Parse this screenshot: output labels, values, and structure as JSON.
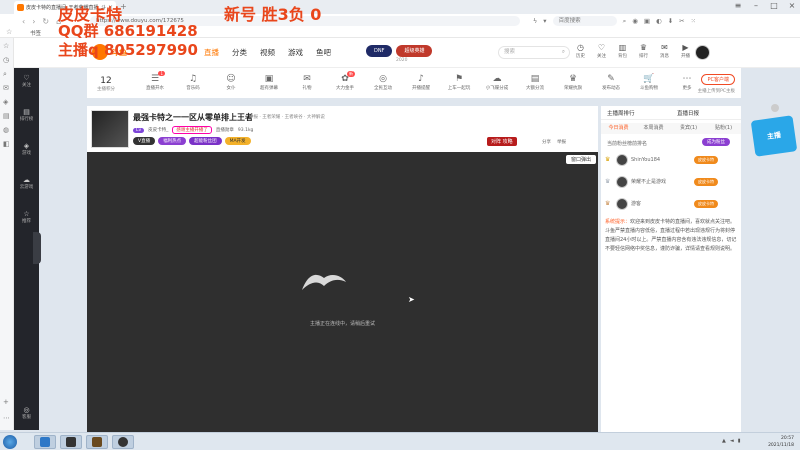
{
  "browser": {
    "tab_title": "皮皮卡特的直播间_王者荣耀直播_斗鱼直播",
    "url": "https://www.douyu.com/172675",
    "search_engine": "百度搜索",
    "bookmark_label": "书签",
    "bookmark_text": "手机收藏夹"
  },
  "overlay": {
    "line1": "皮皮卡特",
    "line2": "新号  胜3负 0",
    "line3": "QQ群 686191428",
    "line4": "主播q 805297990"
  },
  "site": {
    "logo": "斗鱼",
    "nav": [
      "直播",
      "分类",
      "视频",
      "游戏",
      "鱼吧"
    ],
    "promo_a": "DNF",
    "promo_b": "超级英雄",
    "promo_sub": "2020",
    "search_placeholder": "搜索",
    "header_icons": [
      {
        "icon": "history-icon",
        "label": "历史"
      },
      {
        "icon": "follow-icon",
        "label": "关注"
      },
      {
        "icon": "bag-icon",
        "label": "背包"
      },
      {
        "icon": "rank-icon",
        "label": "排行"
      },
      {
        "icon": "message-icon",
        "label": "消息"
      },
      {
        "icon": "camera-icon",
        "label": "开播"
      }
    ]
  },
  "streamer_bar": {
    "level": "12",
    "level_label": "主播积分",
    "tools": [
      {
        "label": "直播开水",
        "glyph": "☰",
        "badge": "1"
      },
      {
        "label": "音乐码",
        "glyph": "♫"
      },
      {
        "label": "女仆",
        "glyph": "☺"
      },
      {
        "label": "超有弹幕",
        "glyph": "▣"
      },
      {
        "label": "礼物",
        "glyph": "✉"
      },
      {
        "label": "大力金手",
        "glyph": "✿",
        "badge": "新"
      },
      {
        "label": "全民互动",
        "glyph": "◎"
      },
      {
        "label": "开播提醒",
        "glyph": "♪"
      },
      {
        "label": "上车一起玩",
        "glyph": "⚑"
      },
      {
        "label": "小飞碟分成",
        "glyph": "☁"
      },
      {
        "label": "大额分流",
        "glyph": "▤"
      },
      {
        "label": "荣耀抗旗",
        "glyph": "♛"
      },
      {
        "label": "发布动态",
        "glyph": "✎"
      },
      {
        "label": "斗鱼购物",
        "glyph": "🛒"
      },
      {
        "label": "更多",
        "glyph": "⋯"
      }
    ],
    "pc_client": "PC客户端",
    "pc_sub": "主播上传到PC主板"
  },
  "room": {
    "title": "最强卡特之一一区从零单排上王者",
    "meta": "举报 · 王者荣耀 · 王者峡谷 · 大神解说",
    "owner": "皮皮卡特_",
    "level_chip": "Lv",
    "fans_chip": "感谢主播开播了",
    "badge_text": "直播勋章",
    "hot": "93.1kg",
    "tags": [
      "V直播",
      "福利热点",
      "超能粉丝团",
      "MA开发"
    ],
    "viewers": "196047",
    "follow": "关注",
    "fight": "对阵 攻略",
    "share": "分享",
    "report": "举报"
  },
  "player": {
    "popout": "窗口弹出",
    "message": "主播正在连线中，请稍后重试"
  },
  "right_panel": {
    "head_a": "主播周排行",
    "head_b": "直播日报",
    "tabs": [
      "今日消费",
      "本周消费",
      "贵宾(1)",
      "贴粉(1)"
    ],
    "rank_header": "当前粉丝榜前排名",
    "become_btn": "成为粉丝",
    "ranks": [
      {
        "name": "ShinYou184",
        "badge": "皮皮卡特"
      },
      {
        "name": "荣耀不止是游戏",
        "badge": "皮皮卡特"
      },
      {
        "name": "游客",
        "badge": "皮皮卡特"
      }
    ],
    "sys_key": "系统提示：",
    "sys_text": "欢迎来到皮皮卡特的直播间，喜欢就点关注吧。斗鱼严禁直播内容低俗，直播过程中若出现违规行为将封停直播间24小时以上。严禁直播内容含有违法违规信息，切记不要轻信网络中奖信息，谨防诈骗，详情请查看规则说明。"
  },
  "left_nav": [
    {
      "icon": "heart-icon",
      "label": "关注"
    },
    {
      "icon": "list-icon",
      "label": "排行榜"
    },
    {
      "icon": "gamepad-icon",
      "label": "游戏"
    },
    {
      "icon": "cloud-icon",
      "label": "云游戏"
    },
    {
      "icon": "star-icon",
      "label": "推荐"
    },
    {
      "icon": "headset-icon",
      "label": "客服"
    }
  ],
  "taskbar": {
    "time": "20:57",
    "date": "2021/11/18"
  }
}
